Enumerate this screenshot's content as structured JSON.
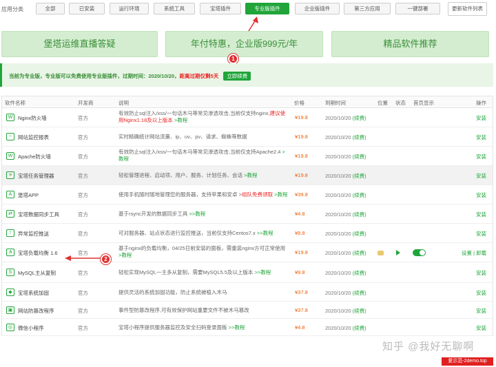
{
  "category": {
    "label": "应用分类",
    "tabs": [
      "全部",
      "已安装",
      "运行环境",
      "系统工具",
      "宝塔插件",
      "专业版插件",
      "企业版插件",
      "第三方应用",
      "一键部署"
    ],
    "active": "专业版插件",
    "update_list": "更新软件列表"
  },
  "banners": [
    "堡塔运维直播答疑",
    "年付特惠，企业版999元/年",
    "精品软件推荐"
  ],
  "notice": {
    "text": "当前为专业版，专业版可以免费使用专业版插件，过期时间：2020/10/20，",
    "warn": "距离过期仅剩5天",
    "renew_btn": "立即续费"
  },
  "table": {
    "headers": [
      "软件名称",
      "开发商",
      "说明",
      "价格",
      "到期时间",
      "位置",
      "状态",
      "首页显示",
      "操作"
    ],
    "rows": [
      {
        "icon": "shield-icon",
        "name": "Nginx防火墙",
        "developer": "官方",
        "desc": "有效防止sql注入/xss/一句话木马等常见渗透攻击,当前仅支持nginx,",
        "desc_red": "建议使用Nginx1.18及以上版本",
        "desc_link": ">教程",
        "price": "¥19.8",
        "expire": "2020/10/20",
        "renew": "(续费)",
        "action": "安装"
      },
      {
        "icon": "monitor-icon",
        "name": "网站监控报表",
        "developer": "官方",
        "desc": "实时精确统计网站流量、ip、uv、pv、请求、蜘蛛等数据",
        "desc_red": "",
        "desc_link": "",
        "price": "¥19.8",
        "expire": "2020/10/20",
        "renew": "(续费)",
        "action": "安装"
      },
      {
        "icon": "shield-icon",
        "name": "Apache防火墙",
        "developer": "官方",
        "desc": "有效防止sql注入/xss/一句话木马等常见渗透攻击,当前仅支持Apache2.4",
        "desc_red": "",
        "desc_link": ">教程",
        "price": "¥19.8",
        "expire": "2020/10/20",
        "renew": "(续费)",
        "action": "安装"
      },
      {
        "icon": "task-icon",
        "name": "宝塔任务管理器",
        "developer": "官方",
        "desc": "轻松管理进程、启动项、用户、服务、计划任务、会话",
        "desc_red": "",
        "desc_link": ">教程",
        "price": "¥19.8",
        "expire": "2020/10/20",
        "renew": "(续费)",
        "action": "安装"
      },
      {
        "icon": "app-icon",
        "name": "堡塔APP",
        "developer": "官方",
        "desc": "使用手机随时随地管理您的服务器，支持苹果和安卓 >",
        "desc_red": "组队免费领取",
        "desc_link": ">教程",
        "price": "¥39.8",
        "expire": "2020/10/20",
        "renew": "(续费)",
        "action": "安装"
      },
      {
        "icon": "sync-icon",
        "name": "宝塔数据同步工具",
        "developer": "官方",
        "desc": "基于rsync开发的数据同步工具",
        "desc_red": "",
        "desc_link": ">>教程",
        "price": "¥4.8",
        "expire": "2020/10/20",
        "renew": "(续费)",
        "action": "安装"
      },
      {
        "icon": "alert-icon",
        "name": "异常监控推送",
        "developer": "官方",
        "desc": "可对服务器、站点状态进行监控推送，当前仅支持Centos7.x",
        "desc_red": "",
        "desc_link": ">>教程",
        "price": "¥9.8",
        "expire": "2020/10/20",
        "renew": "(续费)",
        "action": "安装"
      },
      {
        "icon": "balance-icon",
        "name": "宝塔负载均衡 1.6",
        "developer": "官方",
        "desc": "基于nginx的负载均衡，04/25日前安装的面板，需重装nginx方可正常使用",
        "desc_red": "",
        "desc_link": ">教程",
        "price": "¥19.8",
        "expire": "2020/10/20",
        "renew": "(续费)",
        "action": "设置 | 卸载"
      },
      {
        "icon": "mysql-icon",
        "name": "MySQL主从复制",
        "developer": "官方",
        "desc": "轻松实现MySQL一主多从复制，需要MySQL5.5及以上版本",
        "desc_red": "",
        "desc_link": ">>教程",
        "price": "¥9.8",
        "expire": "2020/10/20",
        "renew": "(续费)",
        "action": "安装"
      },
      {
        "icon": "lock-icon",
        "name": "宝塔系统加固",
        "developer": "官方",
        "desc": "提供灵活的系统加固功能，防止系统被植入木马",
        "desc_red": "",
        "desc_link": "",
        "price": "¥37.8",
        "expire": "2020/10/20",
        "renew": "(续费)",
        "action": "安装"
      },
      {
        "icon": "tamper-icon",
        "name": "网站防篡改程序",
        "developer": "官方",
        "desc": "事件型防篡改程序,可有效保护网站重要文件不被木马篡改",
        "desc_red": "",
        "desc_link": "",
        "price": "¥37.8",
        "expire": "2020/10/20",
        "renew": "(续费)",
        "action": "安装"
      },
      {
        "icon": "wechat-icon",
        "name": "微信小程序",
        "developer": "官方",
        "desc": "宝塔小程序提供服务器监控及安全扫码登录面板",
        "desc_red": "",
        "desc_link": ">>教程",
        "price": "¥4.8",
        "expire": "2020/10/20",
        "renew": "(续费)",
        "action": "安装"
      }
    ]
  },
  "annotations": [
    "1",
    "2"
  ],
  "watermark": {
    "text": "知乎 @我好无聊啊",
    "tag": "爱示范-2demo.top"
  },
  "colors": {
    "brand": "#20a53a",
    "price": "#f05a00",
    "warn": "#e22222",
    "annotation": "#e03030"
  }
}
